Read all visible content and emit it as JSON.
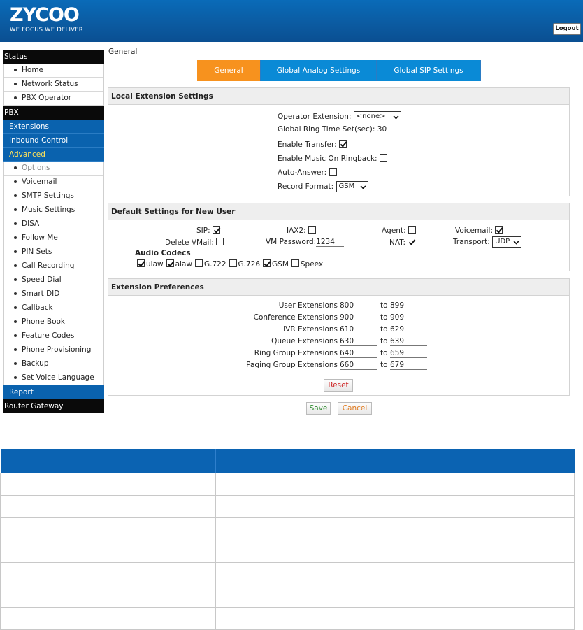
{
  "logo": {
    "name": "ZYCOO",
    "tagline": "WE FOCUS WE DELIVER"
  },
  "header": {
    "logout_label": "Logout"
  },
  "sidebar": {
    "status": "Status",
    "status_items": [
      "Home",
      "Network Status",
      "PBX Operator"
    ],
    "pbx": "PBX",
    "extensions": "Extensions",
    "inbound_control": "Inbound Control",
    "advanced": "Advanced",
    "advanced_items": [
      "Options",
      "Voicemail",
      "SMTP Settings",
      "Music Settings",
      "DISA",
      "Follow Me",
      "PIN Sets",
      "Call Recording",
      "Speed Dial",
      "Smart DID",
      "Callback",
      "Phone Book",
      "Feature Codes",
      "Phone Provisioning",
      "Backup",
      "Set Voice Language"
    ],
    "report": "Report",
    "router_gateway": "Router Gateway"
  },
  "page": {
    "title": "General"
  },
  "tabs": [
    {
      "label": "General",
      "active": true
    },
    {
      "label": "Global Analog Settings",
      "active": false
    },
    {
      "label": "Global SIP Settings",
      "active": false
    }
  ],
  "local_ext": {
    "heading": "Local Extension Settings",
    "operator_label": "Operator Extension:",
    "operator_value": "<none>",
    "ring_time_label": "Global Ring Time Set(sec):",
    "ring_time_value": "30",
    "enable_transfer_label": "Enable Transfer:",
    "enable_transfer": true,
    "music_ringback_label": "Enable Music On Ringback:",
    "music_ringback": false,
    "auto_answer_label": "Auto-Answer:",
    "auto_answer": false,
    "record_format_label": "Record Format:",
    "record_format_value": "GSM"
  },
  "default_user": {
    "heading": "Default Settings for New User",
    "sip_label": "SIP:",
    "sip": true,
    "iax2_label": "IAX2:",
    "iax2": false,
    "agent_label": "Agent:",
    "agent": false,
    "voicemail_label": "Voicemail:",
    "voicemail": true,
    "delete_vmail_label": "Delete VMail:",
    "delete_vmail": false,
    "vm_password_label": "VM Password:",
    "vm_password_value": "1234",
    "nat_label": "NAT:",
    "nat": true,
    "transport_label": "Transport:",
    "transport_value": "UDP",
    "audio_codecs_label": "Audio Codecs",
    "codecs": [
      {
        "name": "ulaw",
        "checked": true
      },
      {
        "name": "alaw",
        "checked": true
      },
      {
        "name": "G.722",
        "checked": false
      },
      {
        "name": "G.726",
        "checked": false
      },
      {
        "name": "GSM",
        "checked": true
      },
      {
        "name": "Speex",
        "checked": false
      }
    ]
  },
  "ext_prefs": {
    "heading": "Extension Preferences",
    "to_label": "to",
    "rows": [
      {
        "label": "User Extensions",
        "from": "800",
        "to": "899"
      },
      {
        "label": "Conference Extensions",
        "from": "900",
        "to": "909"
      },
      {
        "label": "IVR Extensions",
        "from": "610",
        "to": "629"
      },
      {
        "label": "Queue Extensions",
        "from": "630",
        "to": "639"
      },
      {
        "label": "Ring Group Extensions",
        "from": "640",
        "to": "659"
      },
      {
        "label": "Paging Group Extensions",
        "from": "660",
        "to": "679"
      }
    ],
    "reset_label": "Reset"
  },
  "actions": {
    "save_label": "Save",
    "cancel_label": "Cancel"
  },
  "colors": {
    "header_blue": "#0a5aa0",
    "tab_orange": "#f7921e",
    "tab_blue": "#0a8ad6",
    "sidebar_blue": "#0a62ae",
    "advanced_yellow": "#ffe25a",
    "reset_red": "#cc2222",
    "save_green": "#2e8b2e",
    "cancel_orange": "#e0791c"
  }
}
